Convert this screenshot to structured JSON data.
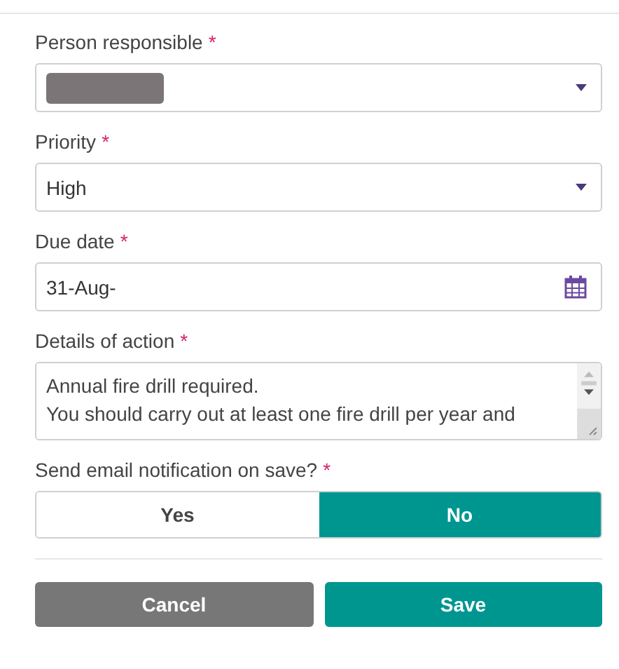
{
  "fields": [
    {
      "kind": "select",
      "label": "Person responsible",
      "required_mark": "*",
      "redacted": true
    },
    {
      "kind": "select",
      "label": "Priority",
      "required_mark": "*",
      "value": "High",
      "redacted": false
    },
    {
      "kind": "date",
      "label": "Due date",
      "required_mark": "*",
      "value": "31-Aug-"
    },
    {
      "kind": "textarea",
      "label": "Details of action",
      "required_mark": "*",
      "value": "Annual fire drill required.\nYou should carry out at least one fire drill per year and"
    },
    {
      "kind": "toggle",
      "label": "Send email notification on save?",
      "required_mark": "*",
      "options": [
        {
          "label": "Yes",
          "selected": false
        },
        {
          "label": "No",
          "selected": true
        }
      ]
    }
  ],
  "buttons": [
    {
      "label": "Cancel",
      "kind": "secondary"
    },
    {
      "label": "Save",
      "kind": "primary"
    }
  ]
}
